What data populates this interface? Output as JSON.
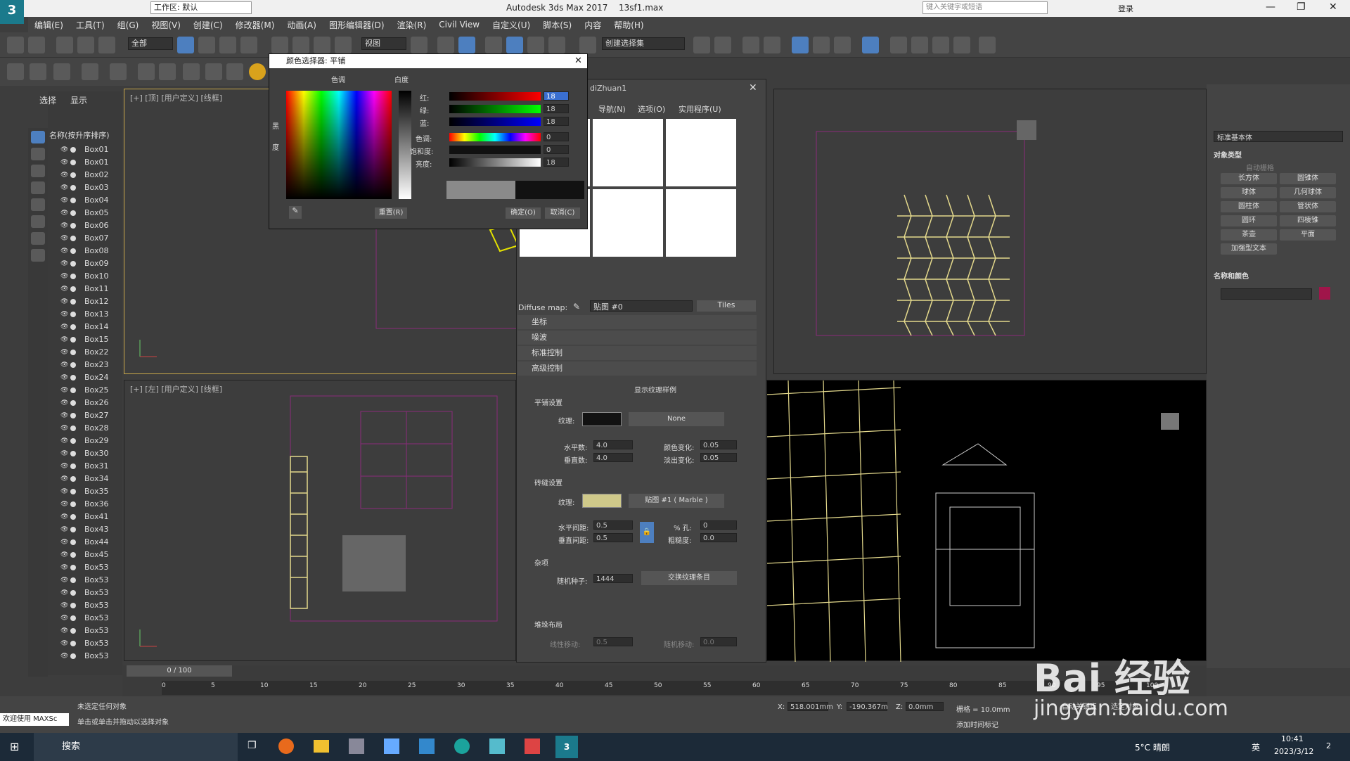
{
  "app": {
    "title": "Autodesk 3ds Max 2017",
    "file": "13sf1.max",
    "workspace": "工作区: 默认",
    "search_placeholder": "键入关键字或短语",
    "login": "登录",
    "logo": "3"
  },
  "menu": [
    "编辑(E)",
    "工具(T)",
    "组(G)",
    "视图(V)",
    "创建(C)",
    "修改器(M)",
    "动画(A)",
    "图形编辑器(D)",
    "渲染(R)",
    "Civil View",
    "自定义(U)",
    "脚本(S)",
    "内容",
    "帮助(H)"
  ],
  "toolbar": {
    "filter": "全部",
    "view": "视图",
    "selection_set": "创建选择集"
  },
  "scene_explorer": {
    "tab_select": "选择",
    "tab_display": "显示",
    "header": "名称(按升序排序)",
    "items": [
      "Box01",
      "Box01",
      "Box02",
      "Box03",
      "Box04",
      "Box05",
      "Box06",
      "Box07",
      "Box08",
      "Box09",
      "Box10",
      "Box11",
      "Box12",
      "Box13",
      "Box14",
      "Box15",
      "Box22",
      "Box23",
      "Box24",
      "Box25",
      "Box26",
      "Box27",
      "Box28",
      "Box29",
      "Box30",
      "Box31",
      "Box34",
      "Box35",
      "Box36",
      "Box41",
      "Box43",
      "Box44",
      "Box45",
      "Box53",
      "Box53",
      "Box53",
      "Box53",
      "Box53",
      "Box53",
      "Box53",
      "Box53"
    ]
  },
  "viewports": {
    "top": "[+] [顶] [用户定义] [线框]",
    "left": "[+] [左] [用户定义] [线框]"
  },
  "color_picker": {
    "title": "颜色选择器: 平铺",
    "hue_label": "色调",
    "white_label": "白度",
    "black_label": "黑",
    "degree_label": "度",
    "rows": [
      {
        "label": "红:",
        "value": "18"
      },
      {
        "label": "绿:",
        "value": "18"
      },
      {
        "label": "蓝:",
        "value": "18"
      },
      {
        "label": "色调:",
        "value": "0"
      },
      {
        "label": "饱和度:",
        "value": "0"
      },
      {
        "label": "亮度:",
        "value": "18"
      }
    ],
    "reset": "重置(R)",
    "ok": "确定(O)",
    "cancel": "取消(C)"
  },
  "material_editor": {
    "title": "diZhuan1",
    "menu": [
      "导航(N)",
      "选项(O)",
      "实用程序(U)"
    ],
    "diffuse_label": "Diffuse map:",
    "map_name": "贴图 #0",
    "map_type": "Tiles",
    "rollouts": [
      "坐标",
      "噪波",
      "标准控制",
      "高级控制"
    ],
    "show_tex": "显示纹理样例",
    "tile_setup": "平铺设置",
    "texture_label": "纹理:",
    "none": "None",
    "h_count_label": "水平数:",
    "h_count": "4.0",
    "v_count_label": "垂直数:",
    "v_count": "4.0",
    "color_var_label": "颜色变化:",
    "color_var": "0.05",
    "fade_var_label": "淡出变化:",
    "fade_var": "0.05",
    "grout_setup": "砖缝设置",
    "grout_map": "贴图 #1 ( Marble )",
    "h_gap_label": "水平间距:",
    "h_gap": "0.5",
    "v_gap_label": "垂直间距:",
    "v_gap": "0.5",
    "holes_label": "% 孔:",
    "holes": "0",
    "rough_label": "粗糙度:",
    "rough": "0.0",
    "misc": "杂项",
    "seed_label": "随机种子:",
    "seed": "1444",
    "swap": "交换纹理条目",
    "stack": "堆垛布局",
    "line_shift_label": "线性移动:",
    "line_shift": "0.5",
    "rand_shift_label": "随机移动:",
    "rand_shift": "0.0"
  },
  "command_panel": {
    "category": "标准基本体",
    "object_type": "对象类型",
    "autogrid": "自动栅格",
    "buttons": [
      "长方体",
      "圆锥体",
      "球体",
      "几何球体",
      "圆柱体",
      "管状体",
      "圆环",
      "四棱锥",
      "茶壶",
      "平面",
      "加强型文本"
    ],
    "name_color": "名称和颜色"
  },
  "timeline": {
    "frame": "0 / 100",
    "ticks": [
      "0",
      "5",
      "10",
      "15",
      "20",
      "25",
      "30",
      "35",
      "40",
      "45",
      "50",
      "55",
      "60",
      "65",
      "70",
      "75",
      "80",
      "85",
      "90",
      "95",
      "100"
    ]
  },
  "status": {
    "line1": "未选定任何对象",
    "line2": "单击或单击并拖动以选择对象",
    "welcome": "欢迎使用 MAXSc",
    "x": "518.001mm",
    "y": "-190.367m",
    "z": "0.0mm",
    "grid": "栅格 = 10.0mm",
    "add_time_tag": "添加时间标记",
    "auto_key": "自动关键点",
    "set_key": "选定对象"
  },
  "taskbar": {
    "search": "搜索",
    "weather": "5°C 晴朗",
    "ime": "英",
    "time": "10:41",
    "date": "2023/3/12",
    "notif": "2"
  },
  "watermark": {
    "main": "Bai 经验",
    "sub": "jingyan.baidu.com"
  }
}
